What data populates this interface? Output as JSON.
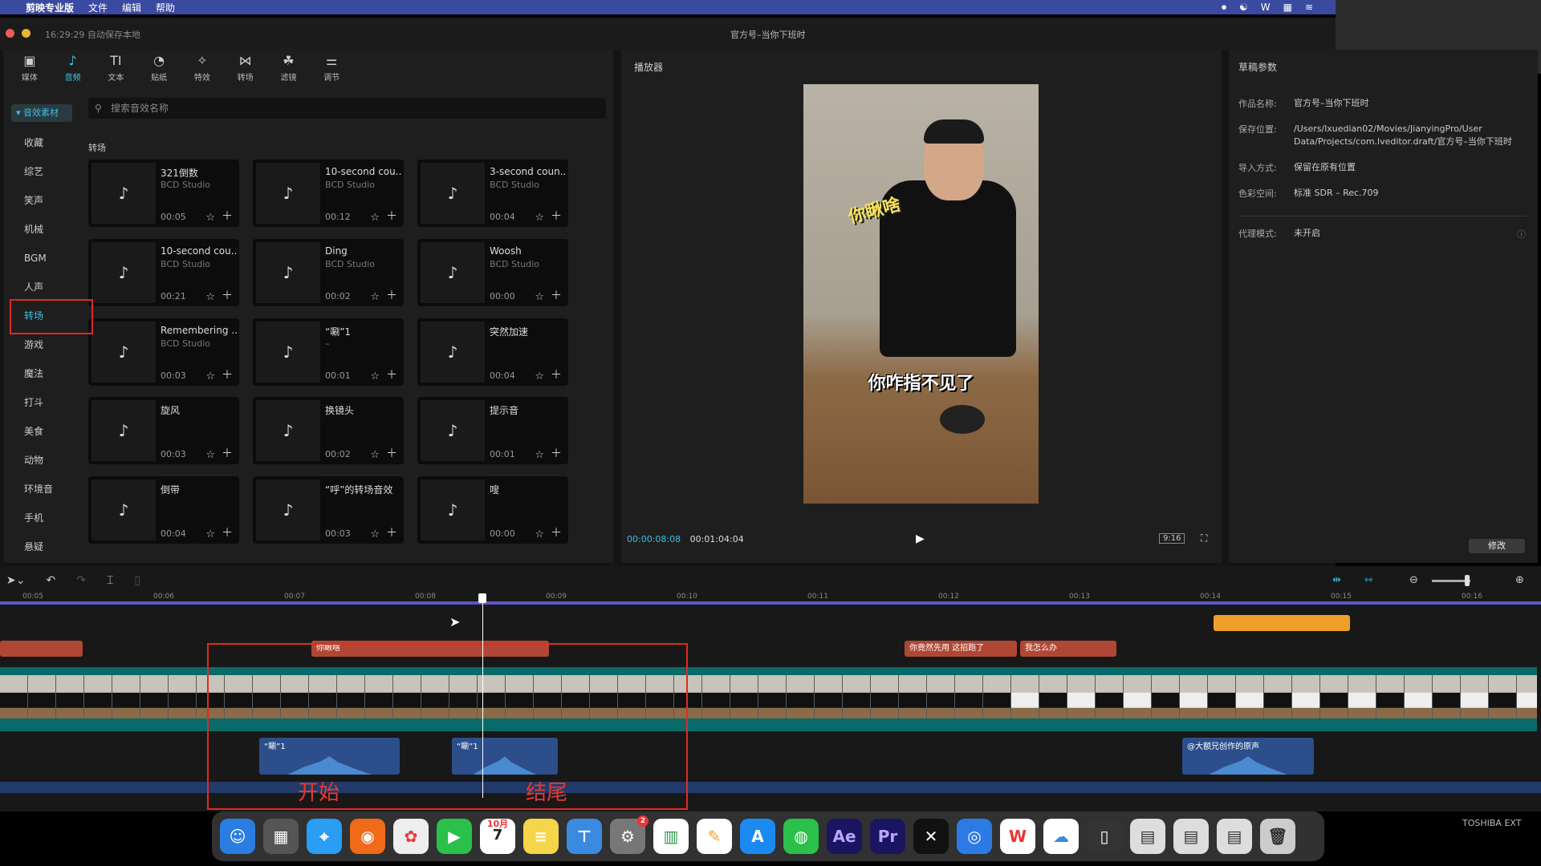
{
  "menubar": {
    "app": "剪映专业版",
    "items": [
      "文件",
      "编辑",
      "帮助"
    ]
  },
  "titlebar": {
    "autosave": "16:29:29 自动保存本地",
    "project": "官方号–当你下班时"
  },
  "toolbar": [
    {
      "label": "媒体",
      "icon": "media-icon"
    },
    {
      "label": "音频",
      "icon": "audio-icon"
    },
    {
      "label": "文本",
      "icon": "text-icon"
    },
    {
      "label": "贴纸",
      "icon": "sticker-icon"
    },
    {
      "label": "特效",
      "icon": "effects-icon"
    },
    {
      "label": "转场",
      "icon": "transition-icon"
    },
    {
      "label": "滤镜",
      "icon": "filter-icon"
    },
    {
      "label": "调节",
      "icon": "adjust-icon"
    }
  ],
  "sidebar": {
    "header": "音效素材",
    "items": [
      "收藏",
      "综艺",
      "笑声",
      "机械",
      "BGM",
      "人声",
      "转场",
      "游戏",
      "魔法",
      "打斗",
      "美食",
      "动物",
      "环境音",
      "手机",
      "悬疑"
    ],
    "active": "转场"
  },
  "search": {
    "placeholder": "搜索音效名称"
  },
  "section": "转场",
  "cards": [
    {
      "title": "321倒数",
      "studio": "BCD Studio",
      "duration": "00:05"
    },
    {
      "title": "10-second cou...",
      "studio": "BCD Studio",
      "duration": "00:12"
    },
    {
      "title": "3-second coun...",
      "studio": "BCD Studio",
      "duration": "00:04"
    },
    {
      "title": "10-second cou...",
      "studio": "BCD Studio",
      "duration": "00:21"
    },
    {
      "title": "Ding",
      "studio": "BCD Studio",
      "duration": "00:02"
    },
    {
      "title": "Woosh",
      "studio": "BCD Studio",
      "duration": "00:00"
    },
    {
      "title": "Remembering ...",
      "studio": "BCD Studio",
      "duration": "00:03"
    },
    {
      "title": "“唰”1",
      "studio": "–",
      "duration": "00:01"
    },
    {
      "title": "突然加速",
      "studio": "",
      "duration": "00:04"
    },
    {
      "title": "旋风",
      "studio": "",
      "duration": "00:03"
    },
    {
      "title": "换镜头",
      "studio": "",
      "duration": "00:02"
    },
    {
      "title": "提示音",
      "studio": "",
      "duration": "00:01"
    },
    {
      "title": "倒带",
      "studio": "",
      "duration": "00:04"
    },
    {
      "title": "“呼”的转场音效",
      "studio": "",
      "duration": "00:03"
    },
    {
      "title": "嗖",
      "studio": "",
      "duration": "00:00"
    }
  ],
  "player": {
    "title": "播放器",
    "sticker_text": "你瞅啥",
    "caption": "你咋指不见了",
    "time_current": "00:00:08:08",
    "time_total": "00:01:04:04",
    "ratio": "9:16"
  },
  "params": {
    "title": "草稿参数",
    "rows": [
      {
        "label": "作品名称:",
        "value": "官方号–当你下班时"
      },
      {
        "label": "保存位置:",
        "value": "/Users/lxuedian02/Movies/JianyingPro/User Data/Projects/com.lveditor.draft/官方号–当你下班时"
      },
      {
        "label": "导入方式:",
        "value": "保留在原有位置"
      },
      {
        "label": "色彩空间:",
        "value": "标准 SDR – Rec.709"
      },
      {
        "label": "代理模式:",
        "value": "未开启"
      }
    ],
    "modify": "修改"
  },
  "timeline": {
    "ruler": [
      "00:05",
      "00:06",
      "00:07",
      "00:08",
      "00:09",
      "00:10",
      "00:11",
      "00:12",
      "00:13",
      "00:14",
      "00:15",
      "00:16"
    ],
    "text_clips": [
      "你瞅啥",
      "你竟然先用 这招跑了",
      "我怎么办"
    ],
    "audio_clips": [
      "“唰”1",
      "“唰”1",
      "@大额兄创作的原声"
    ],
    "label_start": "开始",
    "label_end": "结尾"
  },
  "dock": {
    "calendar_month": "10月",
    "calendar_day": "7",
    "settings_badge": "2"
  },
  "colors": {
    "accent": "#39c2e5",
    "annotation": "#e02a22",
    "text_clip": "#b04734",
    "video_track": "#0a6a6a",
    "audio_clip": "#2c4e8a"
  },
  "toshiba": "TOSHIBA EXT"
}
